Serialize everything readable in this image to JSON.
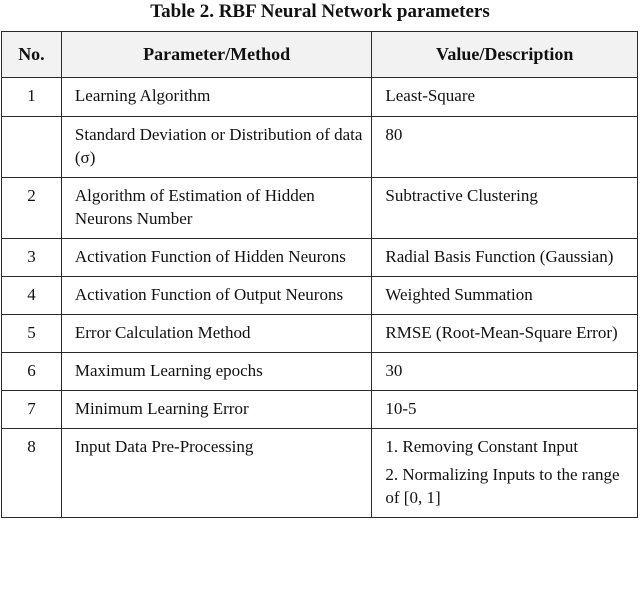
{
  "caption": "Table 2. RBF Neural Network parameters",
  "table": {
    "headers": [
      "No.",
      "Parameter/Method",
      "Value/Description"
    ],
    "rows": [
      {
        "no": "1",
        "parameter": "Learning Algorithm",
        "value": [
          "Least-Square"
        ]
      },
      {
        "no": "",
        "parameter": "Standard Deviation or Distribution of data (σ)",
        "value": [
          "80"
        ]
      },
      {
        "no": "2",
        "parameter": "Algorithm of Estimation of Hidden Neurons Number",
        "value": [
          "Subtractive Clustering"
        ]
      },
      {
        "no": "3",
        "parameter": "Activation Function of Hidden Neurons",
        "value": [
          "Radial Basis Function (Gaussian)"
        ]
      },
      {
        "no": "4",
        "parameter": "Activation Function of Output Neurons",
        "value": [
          "Weighted Summation"
        ]
      },
      {
        "no": "5",
        "parameter": "Error Calculation Method",
        "value": [
          "RMSE (Root-Mean-Square Error)"
        ]
      },
      {
        "no": "6",
        "parameter": "Maximum Learning epochs",
        "value": [
          "30"
        ]
      },
      {
        "no": "7",
        "parameter": "Minimum Learning Error",
        "value": [
          "10-5"
        ]
      },
      {
        "no": "8",
        "parameter": "Input Data Pre-Processing",
        "value": [
          "1. Removing Constant Input",
          "2. Normalizing Inputs to the range of [0, 1]"
        ]
      }
    ]
  }
}
